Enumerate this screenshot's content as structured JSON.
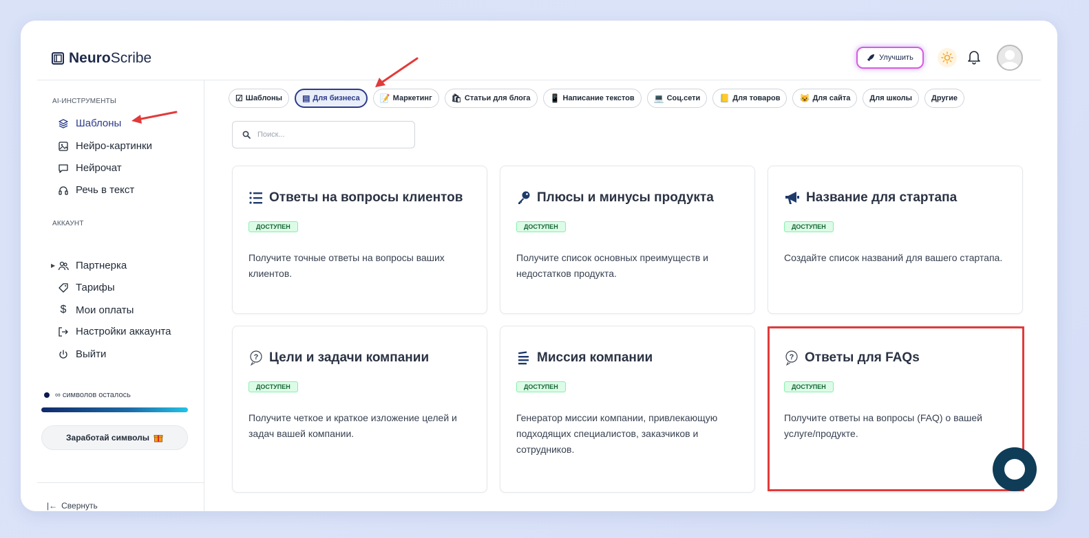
{
  "app": {
    "logo_bold": "Neuro",
    "logo_regular": "Scribe"
  },
  "header": {
    "upgrade_label": "Улучшить"
  },
  "sidebar": {
    "section_tools": "AI-ИНСТРУМЕНТЫ",
    "tools": [
      {
        "label": "Шаблоны",
        "icon": "layers-icon"
      },
      {
        "label": "Нейро-картинки",
        "icon": "image-icon"
      },
      {
        "label": "Нейрочат",
        "icon": "chat-icon"
      },
      {
        "label": "Речь в текст",
        "icon": "headphones-icon"
      }
    ],
    "section_account": "АККАУНТ",
    "account": [
      {
        "label": "Партнерка",
        "icon": "users-icon"
      },
      {
        "label": "Тарифы",
        "icon": "tag-icon"
      },
      {
        "label": "Мои оплаты",
        "icon": "dollar-icon"
      },
      {
        "label": "Настройки аккаунта",
        "icon": "logout-arrow-icon"
      },
      {
        "label": "Выйти",
        "icon": "power-icon"
      }
    ],
    "symbols_value": "∞",
    "symbols_text": "символов осталось",
    "symbols_fill_fraction": 1.0,
    "earn_label": "Заработай символы",
    "collapse_label": "Свернуть"
  },
  "tabs": [
    {
      "label": "Шаблоны",
      "icon": "☑"
    },
    {
      "label": "Для бизнеса",
      "icon": "▤",
      "active": true
    },
    {
      "label": "Маркетинг",
      "icon": "📝"
    },
    {
      "label": "Статьи для блога",
      "icon": "🛍"
    },
    {
      "label": "Написание текстов",
      "icon": "📱"
    },
    {
      "label": "Соц.сети",
      "icon": "💻"
    },
    {
      "label": "Для товаров",
      "icon": "📒"
    },
    {
      "label": "Для сайта",
      "icon": "😺"
    },
    {
      "label": "Для школы",
      "icon": ""
    },
    {
      "label": "Другие",
      "icon": ""
    }
  ],
  "search": {
    "placeholder": "Поиск..."
  },
  "cards": [
    {
      "title": "Ответы на вопросы клиентов",
      "icon": "list-icon",
      "badge": "ДОСТУПЕН",
      "desc": "Получите точные ответы на вопросы ваших клиентов."
    },
    {
      "title": "Плюсы и минусы продукта",
      "icon": "key-icon",
      "badge": "ДОСТУПЕН",
      "desc": "Получите список основных преимуществ и недостатков продукта."
    },
    {
      "title": "Название для стартапа",
      "icon": "megaphone-icon",
      "badge": "ДОСТУПЕН",
      "desc": "Создайте список названий для вашего стартапа."
    },
    {
      "title": "Цели и задачи компании",
      "icon": "question-icon",
      "badge": "ДОСТУПЕН",
      "desc": "Получите четкое и краткое изложение целей и задач вашей компании."
    },
    {
      "title": "Миссия компании",
      "icon": "lines-icon",
      "badge": "ДОСТУПЕН",
      "desc": "Генератор миссии компании, привлекающую подходящих специалистов, заказчиков и сотрудников."
    },
    {
      "title": "Ответы для FAQs",
      "icon": "question-icon",
      "badge": "ДОСТУПЕН",
      "desc": "Получите ответы на вопросы (FAQ) о вашей услуге/продукте."
    }
  ],
  "colors": {
    "accent": "#2b3a8a",
    "badge_bg": "#dcfce7",
    "highlight": "#e23a3a",
    "annotation_arrow": "#e23a3a"
  }
}
